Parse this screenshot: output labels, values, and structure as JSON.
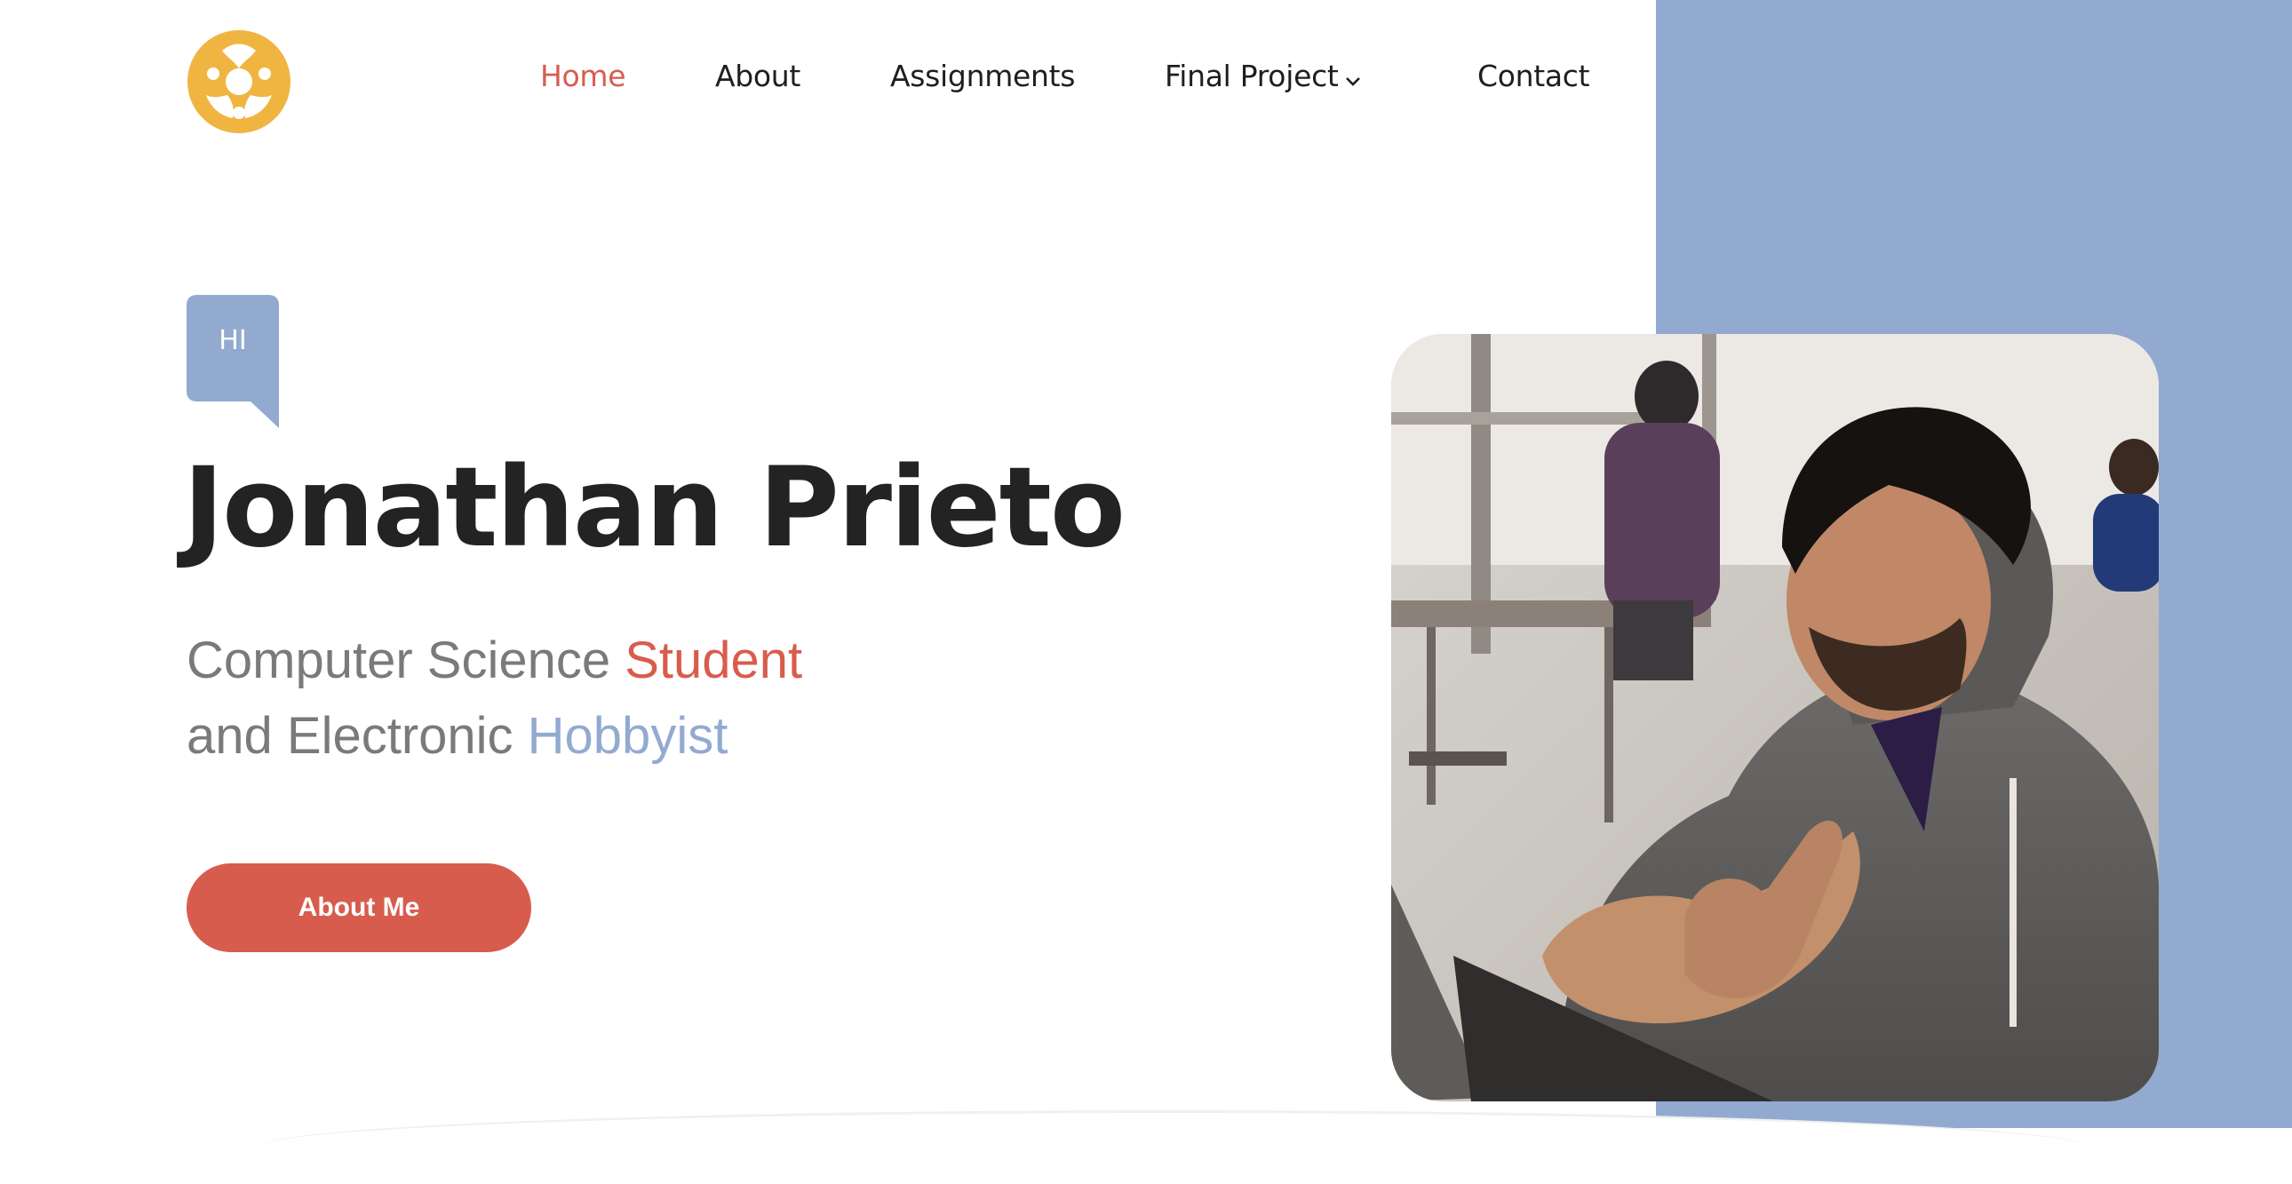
{
  "colors": {
    "accent_red": "#d85c4d",
    "accent_blue": "#93aad0",
    "logo_yellow": "#f0b541",
    "text_dark": "#232323"
  },
  "logo": {
    "icon": "triskelion-logo-icon"
  },
  "nav": {
    "items": [
      {
        "label": "Home",
        "active": true
      },
      {
        "label": "About"
      },
      {
        "label": "Assignments"
      },
      {
        "label": "Final Project",
        "has_dropdown": true
      },
      {
        "label": "Contact"
      }
    ]
  },
  "hero": {
    "greeting": "HI",
    "name": "Jonathan Prieto",
    "subtitle_line1_prefix": "Computer Science ",
    "subtitle_line1_highlight": "Student",
    "subtitle_line2_prefix": "and Electronic ",
    "subtitle_line2_highlight": "Hobbyist",
    "cta_label": "About Me",
    "photo": "portrait-photo"
  }
}
